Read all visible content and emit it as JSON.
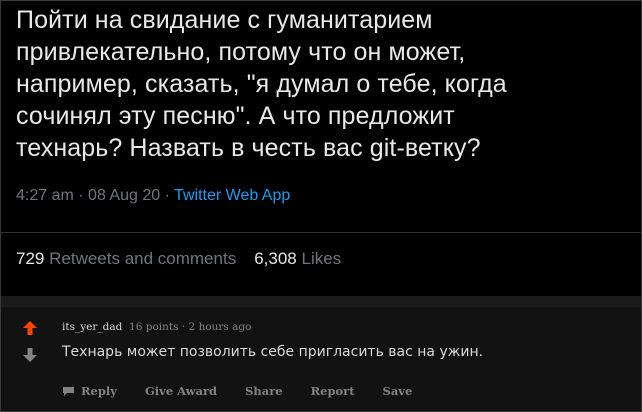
{
  "tweet": {
    "text": "Пойти на свидание с гуманитарием\nпривлекательно, потому что он может,\nнапример, сказать, \"я думал о тебе, когда\nсочинял эту песню\". А что предложит\nтехнарь? Назвать в честь вас git-ветку?",
    "time": "4:27 am",
    "date": "08 Aug 20",
    "app": "Twitter Web App",
    "retweets_count": "729",
    "retweets_label": "Retweets and comments",
    "likes_count": "6,308",
    "likes_label": "Likes"
  },
  "comment": {
    "username": "its_yer_dad",
    "points": "16 points",
    "age": "2 hours ago",
    "text": "Технарь может позволить себе пригласить вас на ужин.",
    "actions": {
      "reply": "Reply",
      "award": "Give Award",
      "share": "Share",
      "report": "Report",
      "save": "Save"
    }
  },
  "colors": {
    "upvote": "#ff4500",
    "link": "#1d9bf0",
    "muted": "#6e767d"
  }
}
